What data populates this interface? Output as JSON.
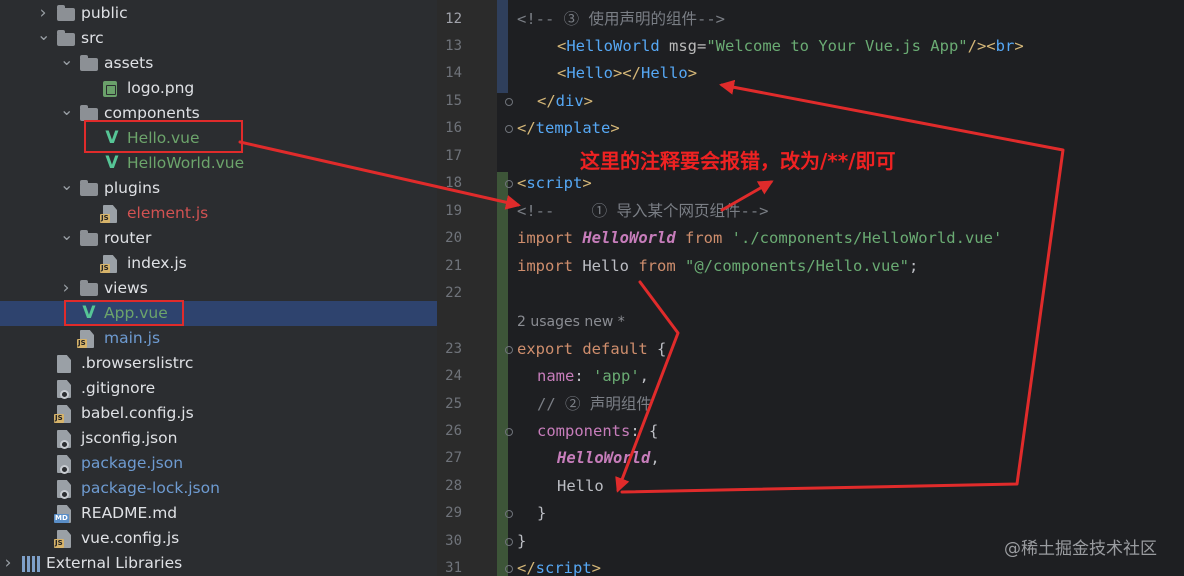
{
  "tree": [
    {
      "label": "public",
      "type": "folder",
      "indent": 1,
      "chevron": "right",
      "icon": "folder-icon"
    },
    {
      "label": "src",
      "type": "folder",
      "indent": 1,
      "chevron": "down",
      "icon": "folder-icon"
    },
    {
      "label": "assets",
      "type": "folder",
      "indent": 2,
      "chevron": "down",
      "icon": "folder-icon"
    },
    {
      "label": "logo.png",
      "type": "image",
      "indent": 3,
      "icon": "image-file-icon"
    },
    {
      "label": "components",
      "type": "folder",
      "indent": 2,
      "chevron": "down",
      "icon": "folder-icon"
    },
    {
      "label": "Hello.vue",
      "type": "vue",
      "indent": 3,
      "icon": "vue-file-icon"
    },
    {
      "label": "HelloWorld.vue",
      "type": "vue",
      "indent": 3,
      "icon": "vue-file-icon"
    },
    {
      "label": "plugins",
      "type": "folder",
      "indent": 2,
      "chevron": "down",
      "icon": "folder-icon"
    },
    {
      "label": "element.js",
      "type": "js-err",
      "indent": 3,
      "icon": "js-file-icon"
    },
    {
      "label": "router",
      "type": "folder",
      "indent": 2,
      "chevron": "down",
      "icon": "folder-icon"
    },
    {
      "label": "index.js",
      "type": "js",
      "indent": 3,
      "icon": "js-file-icon"
    },
    {
      "label": "views",
      "type": "folder",
      "indent": 2,
      "chevron": "right",
      "icon": "folder-icon"
    },
    {
      "label": "App.vue",
      "type": "vue",
      "indent": 2,
      "icon": "vue-file-icon",
      "selected": true
    },
    {
      "label": "main.js",
      "type": "js-blue",
      "indent": 2,
      "icon": "js-file-icon"
    },
    {
      "label": ".browserslistrc",
      "type": "file",
      "indent": 1,
      "icon": "text-file-icon"
    },
    {
      "label": ".gitignore",
      "type": "file-gear",
      "indent": 1,
      "icon": "gitignore-file-icon"
    },
    {
      "label": "babel.config.js",
      "type": "js",
      "indent": 1,
      "icon": "js-file-icon"
    },
    {
      "label": "jsconfig.json",
      "type": "file-gear",
      "indent": 1,
      "icon": "json-file-icon"
    },
    {
      "label": "package.json",
      "type": "file-gear-blue",
      "indent": 1,
      "icon": "json-file-icon"
    },
    {
      "label": "package-lock.json",
      "type": "file-gear-blue",
      "indent": 1,
      "icon": "json-file-icon"
    },
    {
      "label": "README.md",
      "type": "md",
      "indent": 1,
      "icon": "markdown-file-icon"
    },
    {
      "label": "vue.config.js",
      "type": "js",
      "indent": 1,
      "icon": "js-file-icon"
    },
    {
      "label": "External Libraries",
      "type": "lib",
      "indent": 0,
      "chevron": "right",
      "icon": "library-icon"
    }
  ],
  "editor": {
    "lines": [
      {
        "n": "12",
        "current": true,
        "tokens": [
          [
            "comment",
            "<!-- ③ 使用声明的组件-->"
          ]
        ],
        "indent": 0
      },
      {
        "n": "13",
        "tokens": [
          [
            "tag",
            "<"
          ],
          [
            "tname",
            "HelloWorld"
          ],
          [
            "attr",
            " msg="
          ],
          [
            "str",
            "\"Welcome to Your Vue.js App\""
          ],
          [
            "tag",
            "/><"
          ],
          [
            "tname",
            "br"
          ],
          [
            "tag",
            ">"
          ]
        ],
        "indent": 4
      },
      {
        "n": "14",
        "tokens": [
          [
            "tag",
            "<"
          ],
          [
            "tname",
            "Hello"
          ],
          [
            "tag",
            "></"
          ],
          [
            "tname",
            "Hello"
          ],
          [
            "tag",
            ">"
          ]
        ],
        "indent": 4
      },
      {
        "n": "15",
        "tokens": [
          [
            "tag",
            "</"
          ],
          [
            "tname",
            "div"
          ],
          [
            "tag",
            ">"
          ]
        ],
        "indent": 2
      },
      {
        "n": "16",
        "tokens": [
          [
            "tag",
            "</"
          ],
          [
            "tname",
            "template"
          ],
          [
            "tag",
            ">"
          ]
        ],
        "indent": 0
      },
      {
        "n": "17",
        "tokens": [],
        "indent": 0
      },
      {
        "n": "18",
        "tokens": [
          [
            "tag",
            "<"
          ],
          [
            "tname",
            "script"
          ],
          [
            "tag",
            ">"
          ]
        ],
        "indent": 0
      },
      {
        "n": "19",
        "tokens": [
          [
            "comment",
            "<!--    ① 导入某个网页组件-->"
          ]
        ],
        "indent": 0
      },
      {
        "n": "20",
        "tokens": [
          [
            "kw",
            "import "
          ],
          [
            "cls",
            "HelloWorld"
          ],
          [
            "kw",
            " from "
          ],
          [
            "str",
            "'./components/HelloWorld.vue'"
          ]
        ],
        "indent": 0
      },
      {
        "n": "21",
        "tokens": [
          [
            "kw",
            "import "
          ],
          [
            "plain",
            "Hello "
          ],
          [
            "kw",
            "from "
          ],
          [
            "str",
            "\"@/components/Hello.vue\""
          ],
          [
            "plain",
            ";"
          ]
        ],
        "indent": 0
      },
      {
        "n": "22",
        "tokens": [],
        "indent": 0
      },
      {
        "n": "",
        "hint": "2 usages   new *"
      },
      {
        "n": "23",
        "tokens": [
          [
            "kw",
            "export default "
          ],
          [
            "plain",
            "{"
          ]
        ],
        "indent": 0
      },
      {
        "n": "24",
        "tokens": [
          [
            "prop",
            "name"
          ],
          [
            "plain",
            ": "
          ],
          [
            "str",
            "'app'"
          ],
          [
            "plain",
            ","
          ]
        ],
        "indent": 2
      },
      {
        "n": "25",
        "tokens": [
          [
            "comment",
            "// ② 声明组件"
          ]
        ],
        "indent": 2
      },
      {
        "n": "26",
        "tokens": [
          [
            "prop",
            "components"
          ],
          [
            "plain",
            ": {"
          ]
        ],
        "indent": 2
      },
      {
        "n": "27",
        "tokens": [
          [
            "cls",
            "HelloWorld"
          ],
          [
            "plain",
            ","
          ]
        ],
        "indent": 4
      },
      {
        "n": "28",
        "tokens": [
          [
            "plain",
            "Hello"
          ]
        ],
        "indent": 4
      },
      {
        "n": "29",
        "tokens": [
          [
            "plain",
            "}"
          ]
        ],
        "indent": 2
      },
      {
        "n": "30",
        "tokens": [
          [
            "plain",
            "}"
          ]
        ],
        "indent": 0
      },
      {
        "n": "31",
        "tokens": [
          [
            "tag",
            "</"
          ],
          [
            "tname",
            "script"
          ],
          [
            "tag",
            ">"
          ]
        ],
        "indent": 0
      }
    ]
  },
  "annotation": {
    "note": "这里的注释要会报错，改为/**/即可",
    "color": "#e02b2b"
  },
  "watermark": "@稀土掘金技术社区"
}
